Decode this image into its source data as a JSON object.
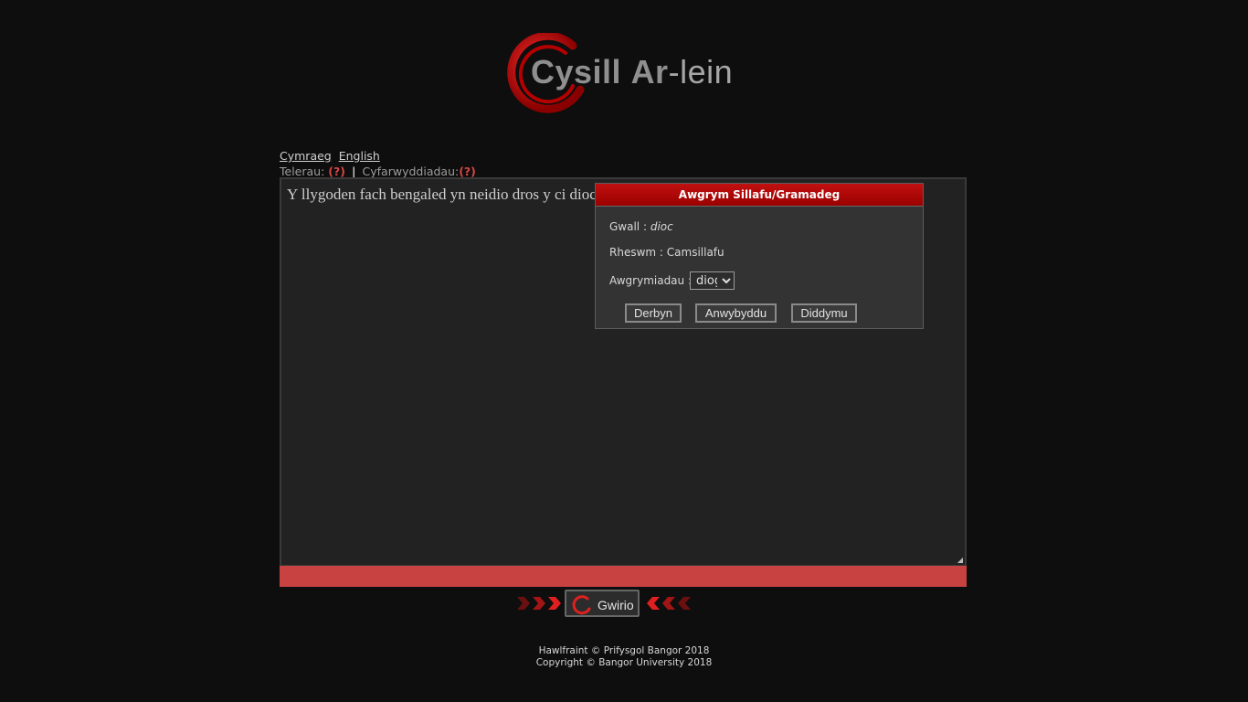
{
  "logo": {
    "part1": "Cysill",
    "part2": "Ar",
    "part3": "-lein",
    "brand_color": "#d00c0c"
  },
  "lang": {
    "welsh": "Cymraeg",
    "english": "English"
  },
  "terms": {
    "terms_label": "Telerau:",
    "terms_link": "(?)",
    "separator": "|",
    "instructions_label": "Cyfarwyddiadau:",
    "instructions_link": "(?)"
  },
  "editor": {
    "text": "Y llygoden fach bengaled yn neidio dros y ci dioc"
  },
  "popup": {
    "title": "Awgrym Sillafu/Gramadeg",
    "error_label": "Gwall :",
    "error_word": "dioc",
    "reason_label": "Rheswm :",
    "reason_value": "Camsillafu",
    "suggestions_label": "Awgrymiadau :",
    "suggestions": [
      "diog"
    ],
    "selected_suggestion": "diog",
    "accept": "Derbyn",
    "ignore": "Anwybyddu",
    "cancel": "Diddymu"
  },
  "check_button": {
    "label": "Gwirio"
  },
  "footer": {
    "line1": "Hawlfraint © Prifysgol Bangor 2018",
    "line2": "Copyright © Bangor University 2018"
  },
  "colors": {
    "accent": "#c94242",
    "title_bar": "#b00000",
    "link_q": "#d64545"
  }
}
